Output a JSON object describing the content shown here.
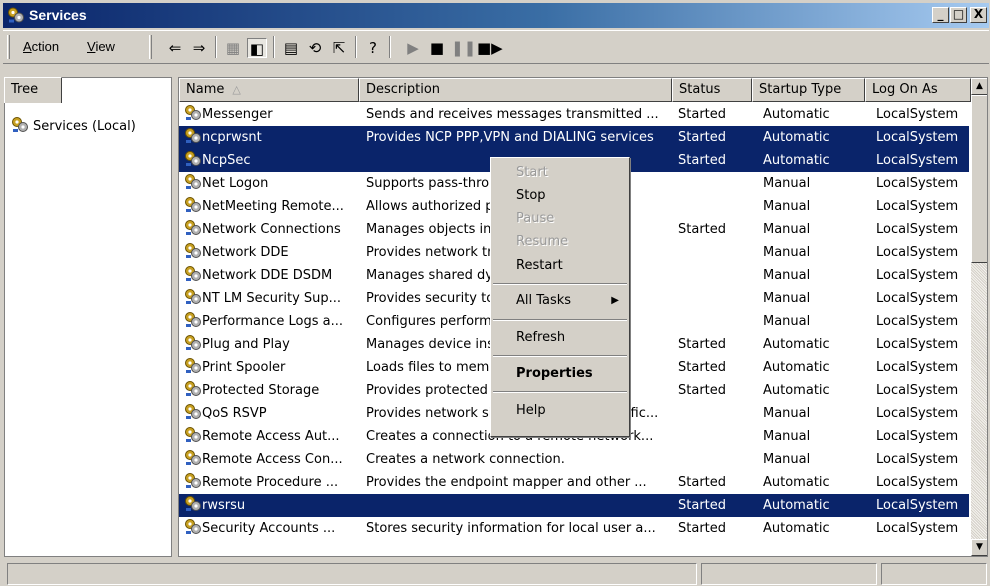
{
  "window": {
    "title": "Services",
    "minimize_label": "_",
    "maximize_label": "□",
    "close_label": "X"
  },
  "menu": {
    "action_prefix": "A",
    "action_rest": "ction",
    "view_prefix": "V",
    "view_rest": "iew"
  },
  "toolbar": {
    "icons": [
      "back-arrow-icon",
      "forward-arrow-icon",
      "up-folder-icon",
      "show-hide-tree-icon",
      "properties-icon",
      "refresh-icon",
      "export-list-icon",
      "help-icon",
      "start-service-icon",
      "stop-service-icon",
      "pause-service-icon",
      "restart-service-icon"
    ]
  },
  "tree": {
    "tab_label": "Tree",
    "root_label": "Services (Local)"
  },
  "columns": {
    "name": "Name",
    "description": "Description",
    "status": "Status",
    "startup": "Startup Type",
    "logon": "Log On As"
  },
  "rows": [
    {
      "name": "Messenger",
      "description": "Sends and receives messages transmitted ...",
      "status": "Started",
      "startup": "Automatic",
      "logon": "LocalSystem",
      "selected": false
    },
    {
      "name": "ncprwsnt",
      "description": "Provides NCP PPP,VPN and DIALING services",
      "status": "Started",
      "startup": "Automatic",
      "logon": "LocalSystem",
      "selected": true
    },
    {
      "name": "NcpSec",
      "description": "",
      "status": "Started",
      "startup": "Automatic",
      "logon": "LocalSystem",
      "selected": true
    },
    {
      "name": "Net Logon",
      "description": "Supports pass-thro                       a...",
      "status": "",
      "startup": "Manual",
      "logon": "LocalSystem",
      "selected": false
    },
    {
      "name": "NetMeeting Remote...",
      "description": "Allows authorized p                      te...",
      "status": "",
      "startup": "Manual",
      "logon": "LocalSystem",
      "selected": false
    },
    {
      "name": "Network Connections",
      "description": "Manages objects in                        -...",
      "status": "Started",
      "startup": "Manual",
      "logon": "LocalSystem",
      "selected": false
    },
    {
      "name": "Network DDE",
      "description": "Provides network tr                       f...",
      "status": "",
      "startup": "Manual",
      "logon": "LocalSystem",
      "selected": false
    },
    {
      "name": "Network DDE DSDM",
      "description": "Manages shared dy                        ...",
      "status": "",
      "startup": "Manual",
      "logon": "LocalSystem",
      "selected": false
    },
    {
      "name": "NT LM Security Sup...",
      "description": "Provides security to                     all...",
      "status": "",
      "startup": "Manual",
      "logon": "LocalSystem",
      "selected": false
    },
    {
      "name": "Performance Logs a...",
      "description": "Configures perform",
      "status": "",
      "startup": "Manual",
      "logon": "LocalSystem",
      "selected": false
    },
    {
      "name": "Plug and Play",
      "description": "Manages device ins                       at...",
      "status": "Started",
      "startup": "Automatic",
      "logon": "LocalSystem",
      "selected": false
    },
    {
      "name": "Print Spooler",
      "description": "Loads files to memo",
      "status": "Started",
      "startup": "Automatic",
      "logon": "LocalSystem",
      "selected": false
    },
    {
      "name": "Protected Storage",
      "description": "Provides protected                        d...",
      "status": "Started",
      "startup": "Automatic",
      "logon": "LocalSystem",
      "selected": false
    },
    {
      "name": "QoS RSVP",
      "description": "Provides network signaling and local traffic...",
      "status": "",
      "startup": "Manual",
      "logon": "LocalSystem",
      "selected": false
    },
    {
      "name": "Remote Access Aut...",
      "description": "Creates a connection to a remote network...",
      "status": "",
      "startup": "Manual",
      "logon": "LocalSystem",
      "selected": false
    },
    {
      "name": "Remote Access Con...",
      "description": "Creates a network connection.",
      "status": "",
      "startup": "Manual",
      "logon": "LocalSystem",
      "selected": false
    },
    {
      "name": "Remote Procedure ...",
      "description": "Provides the endpoint mapper and other ...",
      "status": "Started",
      "startup": "Automatic",
      "logon": "LocalSystem",
      "selected": false
    },
    {
      "name": "rwsrsu",
      "description": "",
      "status": "Started",
      "startup": "Automatic",
      "logon": "LocalSystem",
      "selected": true
    },
    {
      "name": "Security Accounts ...",
      "description": "Stores security information for local user a...",
      "status": "Started",
      "startup": "Automatic",
      "logon": "LocalSystem",
      "selected": false
    }
  ],
  "context_menu": {
    "start": "Start",
    "stop": "Stop",
    "pause": "Pause",
    "resume": "Resume",
    "restart": "Restart",
    "all_tasks": "All Tasks",
    "refresh": "Refresh",
    "properties": "Properties",
    "help": "Help"
  },
  "colors": {
    "selection": "#0a246a",
    "title_gradient_start": "#0a246a",
    "face": "#d4d0c8"
  }
}
